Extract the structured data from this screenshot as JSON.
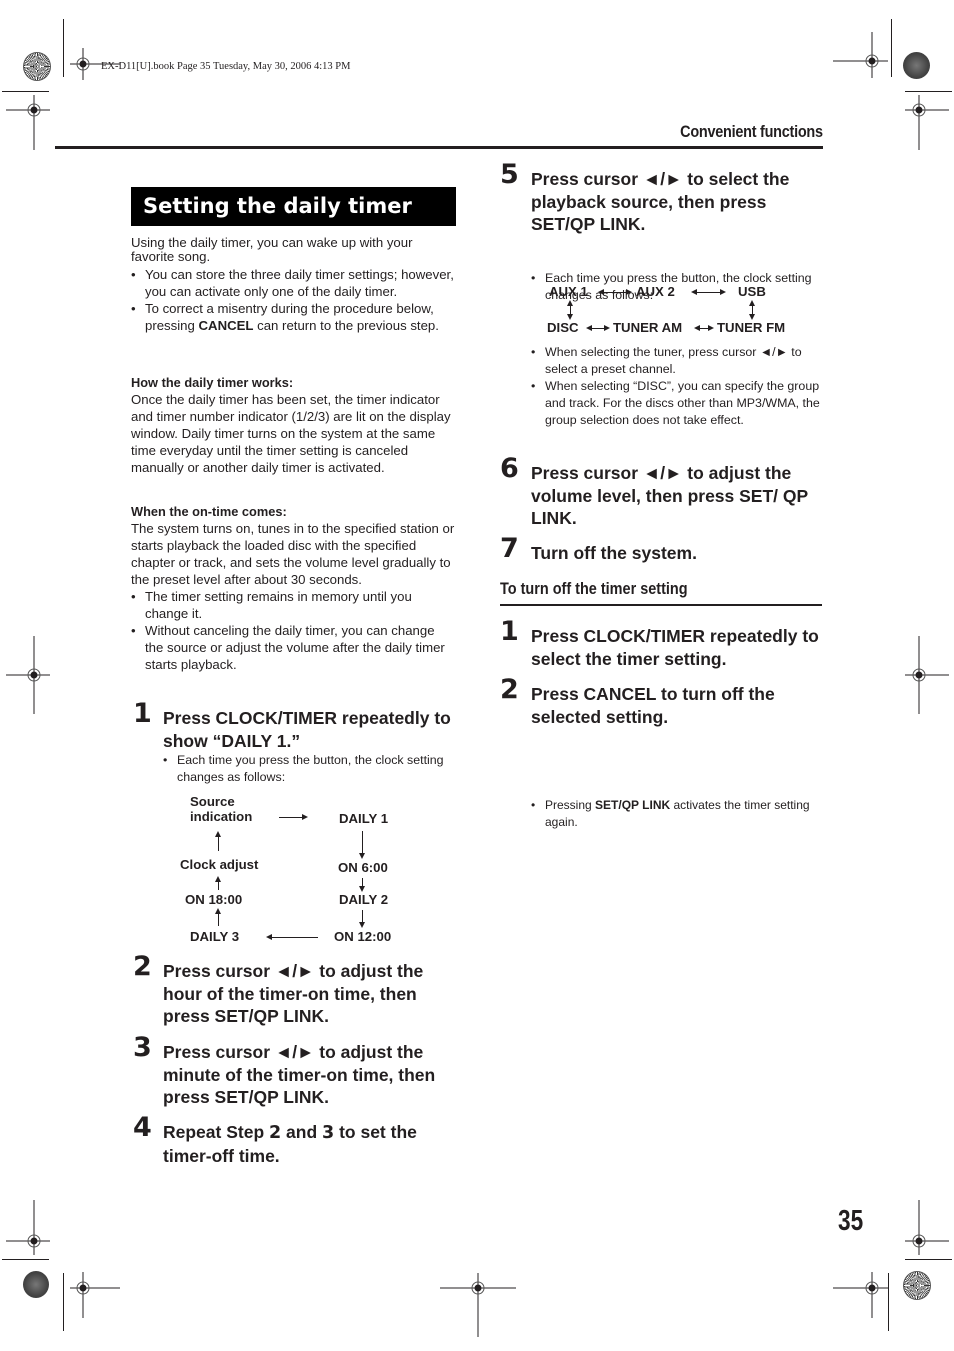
{
  "print_meta": "EX-D11[U].book  Page 35  Tuesday, May 30, 2006  4:13 PM",
  "header": {
    "title": "Convenient functions"
  },
  "section": {
    "title": "Setting the daily timer",
    "intro": "Using the daily timer, you can wake up with your favorite song.",
    "intro_bullets": [
      "You can store the three daily timer settings; however, you can activate only one of the daily timer.",
      {
        "pre": "To correct a misentry during the procedure below, pressing ",
        "bold": "CANCEL",
        "post": " can return to the previous step."
      }
    ],
    "how_works": {
      "heading": "How the daily timer works:",
      "text": "Once the daily timer has been set, the timer indicator and timer number indicator (1/2/3) are lit on the display window. Daily timer turns on the system at the same time everyday until the timer setting is canceled manually or another daily timer is activated."
    },
    "on_time": {
      "heading": "When the on-time comes:",
      "text": "The system turns on, tunes in to the specified station or starts playback the loaded disc with the specified chapter or track, and sets the volume level gradually to the preset level after about 30 seconds.",
      "bullets": [
        "The timer setting remains in memory until you change it.",
        "Without canceling the daily timer, you can change the source or adjust the volume after the daily timer starts playback."
      ]
    }
  },
  "steps": [
    {
      "num": "1",
      "text": "Press CLOCK/TIMER repeatedly to show “DAILY 1.”",
      "note": "Each time you press the button, the clock setting changes as follows:"
    },
    {
      "num": "2",
      "text": "Press cursor ◄/► to adjust the hour of the timer-on time, then press SET/QP LINK."
    },
    {
      "num": "3",
      "text": "Press cursor ◄/► to adjust the minute of the timer-on time, then press SET/QP LINK."
    },
    {
      "num": "4",
      "pre": "Repeat Step ",
      "b1": "2",
      "mid": " and ",
      "b2": "3",
      "post": " to set the timer-off time."
    },
    {
      "num": "5",
      "text": "Press cursor ◄/► to select the playback source, then press SET/QP LINK.",
      "note": "Each time you press the button, the clock setting changes as follows:",
      "bullets": [
        "When selecting the tuner, press cursor ◄/► to select a preset channel.",
        "When selecting “DISC”, you can specify the group and track. For the discs other than MP3/WMA, the group selection does not take effect."
      ]
    },
    {
      "num": "6",
      "text": "Press cursor ◄/► to adjust the volume level, then press SET/ QP LINK."
    },
    {
      "num": "7",
      "text": "Turn off the system."
    }
  ],
  "timer_flow": {
    "source_indication": "Source indication",
    "daily1": "DAILY 1",
    "on600": "ON 6:00",
    "daily2": "DAILY 2",
    "on1200": "ON 12:00",
    "daily3": "DAILY 3",
    "on1800": "ON 18:00",
    "clock_adjust": "Clock adjust"
  },
  "source_flow": {
    "aux1": "AUX 1",
    "aux2": "AUX 2",
    "usb": "USB",
    "disc": "DISC",
    "tuner_am": "TUNER AM",
    "tuner_fm": "TUNER FM"
  },
  "turn_off": {
    "heading": "To turn off the timer setting",
    "steps": [
      {
        "num": "1",
        "text": "Press CLOCK/TIMER repeatedly to select the timer setting."
      },
      {
        "num": "2",
        "text": "Press CANCEL to turn off the selected setting.",
        "note_pre": "Pressing ",
        "note_bold": "SET/QP LINK",
        "note_post": " activates the timer setting again."
      }
    ]
  },
  "page_number": "35"
}
